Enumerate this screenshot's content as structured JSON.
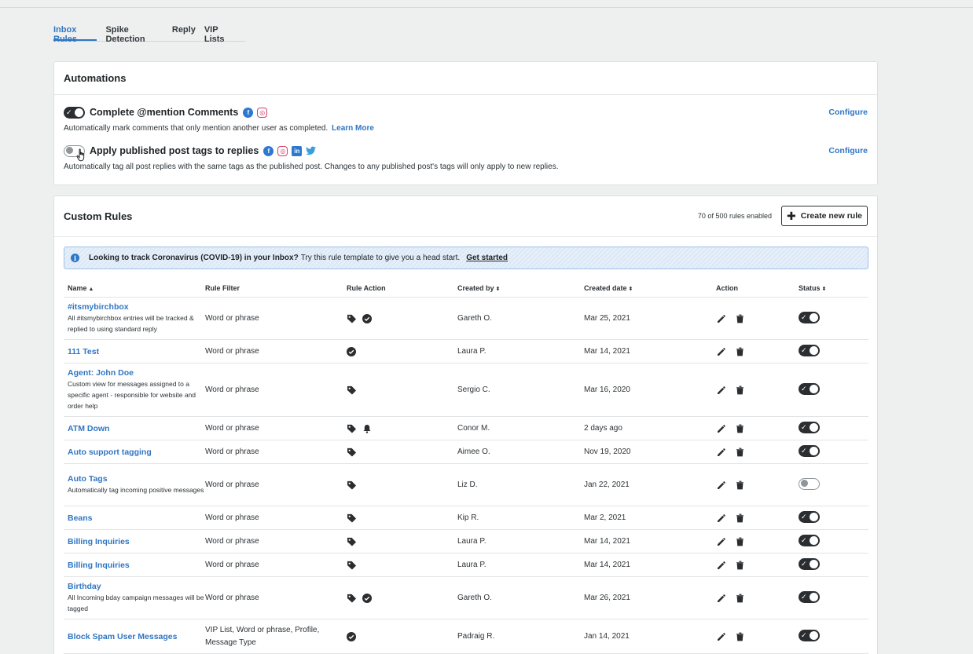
{
  "tabs": [
    {
      "label": "Inbox Rules",
      "active": true
    },
    {
      "label": "Spike Detection",
      "active": false
    },
    {
      "label": "Reply",
      "active": false
    },
    {
      "label": "VIP Lists",
      "active": false
    }
  ],
  "automations": {
    "title": "Automations",
    "items": [
      {
        "title": "Complete @mention Comments",
        "enabled": true,
        "networks": [
          "facebook-icon",
          "instagram-icon"
        ],
        "description": "Automatically mark comments that only mention another user as completed.",
        "learn_more": "Learn More",
        "configure": "Configure"
      },
      {
        "title": "Apply published post tags to replies",
        "enabled": false,
        "networks": [
          "facebook-icon",
          "instagram-icon",
          "linkedin-icon",
          "twitter-icon"
        ],
        "description": "Automatically tag all post replies with the same tags as the published post. Changes to any published post's tags will only apply to new replies.",
        "configure": "Configure"
      }
    ]
  },
  "custom_rules": {
    "title": "Custom Rules",
    "count_text": "70 of 500 rules enabled",
    "create_label": "Create new rule",
    "banner": {
      "bold": "Looking to track Coronavirus (COVID-19) in your Inbox?",
      "text": "Try this rule template to give you a head start.",
      "link": "Get started"
    },
    "columns": {
      "name": "Name",
      "filter": "Rule Filter",
      "action": "Rule Action",
      "created_by": "Created by",
      "created_date": "Created date",
      "row_action": "Action",
      "status": "Status"
    },
    "rows": [
      {
        "name": "#itsmybirchbox",
        "desc": "All #itsmybirchbox entries will be tracked & replied to using standard reply",
        "filter": "Word or phrase",
        "actions": [
          "tag",
          "check"
        ],
        "created_by": "Gareth O.",
        "date": "Mar 25, 2021",
        "enabled": true
      },
      {
        "name": "111 Test",
        "desc": "",
        "filter": "Word or phrase",
        "actions": [
          "check"
        ],
        "created_by": "Laura P.",
        "date": "Mar 14, 2021",
        "enabled": true
      },
      {
        "name": "Agent: John Doe",
        "desc": "Custom view for messages assigned to a specific agent - responsible for website and order help",
        "filter": "Word or phrase",
        "actions": [
          "tag"
        ],
        "created_by": "Sergio C.",
        "date": "Mar 16, 2020",
        "enabled": true
      },
      {
        "name": "ATM Down",
        "desc": "",
        "filter": "Word or phrase",
        "actions": [
          "tag",
          "bell"
        ],
        "created_by": "Conor M.",
        "date": "2 days ago",
        "enabled": true
      },
      {
        "name": "Auto support tagging",
        "desc": "",
        "filter": "Word or phrase",
        "actions": [
          "tag"
        ],
        "created_by": "Aimee O.",
        "date": "Nov 19, 2020",
        "enabled": true
      },
      {
        "name": "Auto Tags",
        "desc": "Automatically tag incoming positive messages",
        "filter": "Word or phrase",
        "actions": [
          "tag"
        ],
        "created_by": "Liz D.",
        "date": "Jan 22, 2021",
        "enabled": false
      },
      {
        "name": "Beans",
        "desc": "",
        "filter": "Word or phrase",
        "actions": [
          "tag"
        ],
        "created_by": "Kip R.",
        "date": "Mar 2, 2021",
        "enabled": true
      },
      {
        "name": "Billing Inquiries",
        "desc": "",
        "filter": "Word or phrase",
        "actions": [
          "tag"
        ],
        "created_by": "Laura P.",
        "date": "Mar 14, 2021",
        "enabled": true
      },
      {
        "name": "Billing Inquiries",
        "desc": "",
        "filter": "Word or phrase",
        "actions": [
          "tag"
        ],
        "created_by": "Laura P.",
        "date": "Mar 14, 2021",
        "enabled": true
      },
      {
        "name": "Birthday",
        "desc": "All Incoming bday campaign messages will be tagged",
        "filter": "Word or phrase",
        "actions": [
          "tag",
          "check"
        ],
        "created_by": "Gareth O.",
        "date": "Mar 26, 2021",
        "enabled": true
      },
      {
        "name": "Block Spam User Messages",
        "desc": "",
        "filter": "VIP List, Word or phrase, Profile, Message Type",
        "actions": [
          "check"
        ],
        "created_by": "Padraig R.",
        "date": "Jan 14, 2021",
        "enabled": true
      }
    ]
  }
}
